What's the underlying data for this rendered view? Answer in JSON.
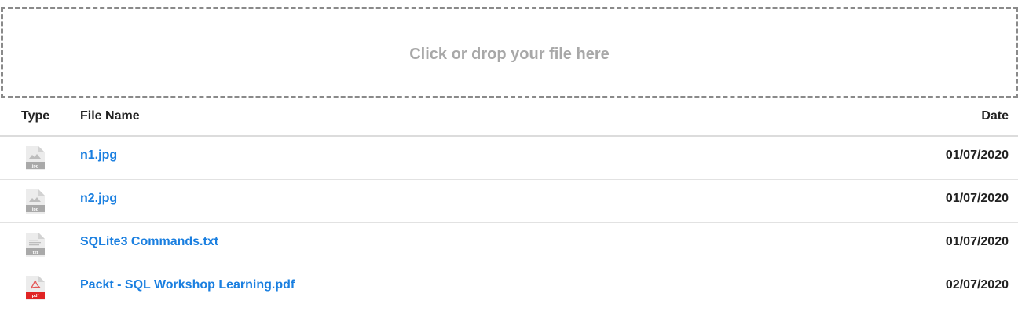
{
  "dropzone": {
    "label": "Click or drop your file here"
  },
  "table": {
    "headers": {
      "type": "Type",
      "name": "File Name",
      "date": "Date"
    },
    "rows": [
      {
        "icon": "jpg-file-icon",
        "ext": "jpg",
        "badge_color": "#a9a9a9",
        "name": "n1.jpg",
        "date": "01/07/2020"
      },
      {
        "icon": "jpg-file-icon",
        "ext": "jpg",
        "badge_color": "#a9a9a9",
        "name": "n2.jpg",
        "date": "01/07/2020"
      },
      {
        "icon": "txt-file-icon",
        "ext": "txt",
        "badge_color": "#a9a9a9",
        "name": "SQLite3 Commands.txt",
        "date": "01/07/2020"
      },
      {
        "icon": "pdf-file-icon",
        "ext": "pdf",
        "badge_color": "#e02424",
        "name": "Packt - SQL Workshop Learning.pdf",
        "date": "02/07/2020"
      }
    ]
  }
}
